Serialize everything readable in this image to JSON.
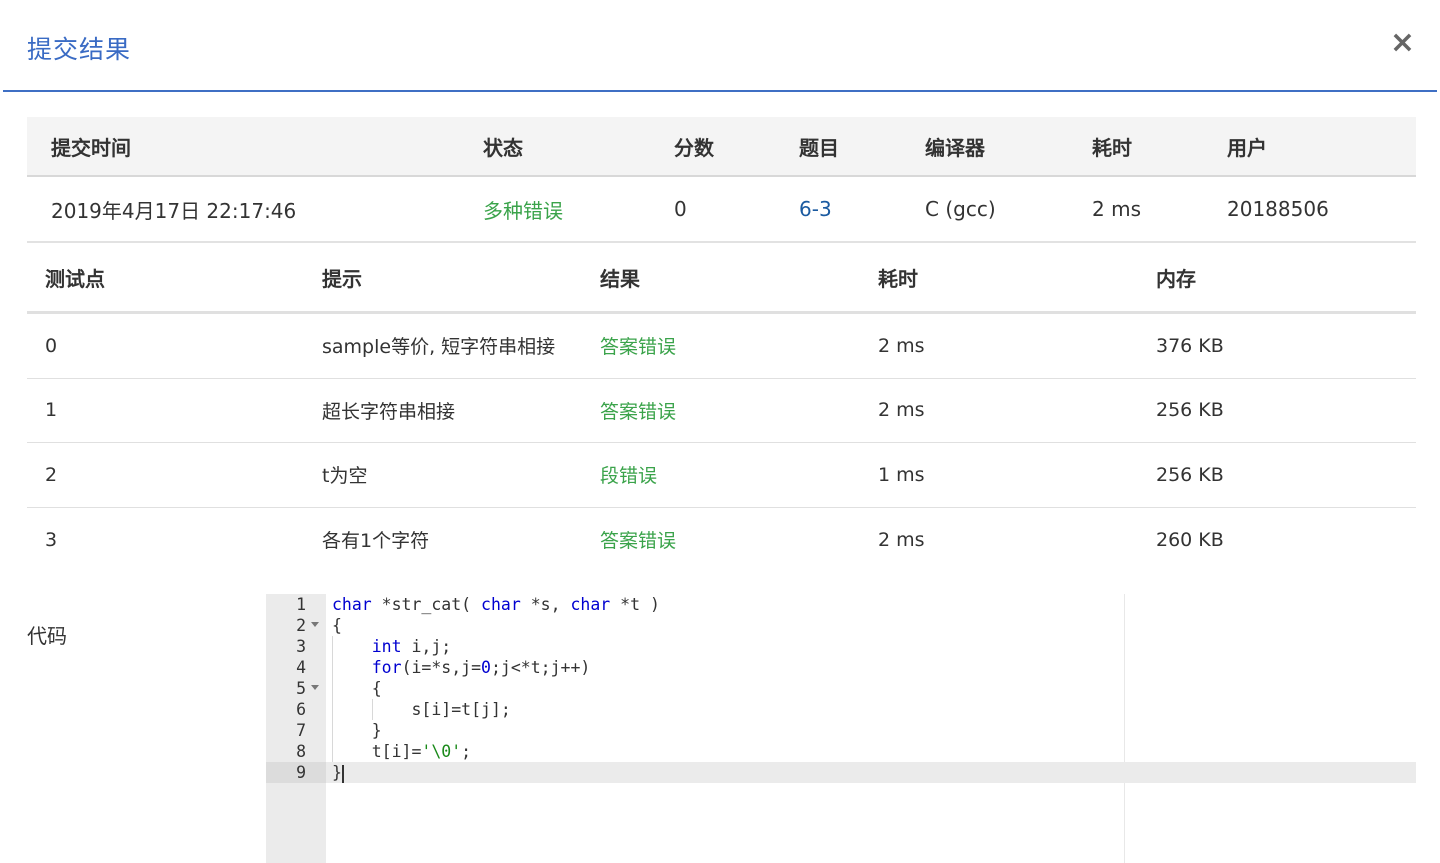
{
  "modal": {
    "title": "提交结果",
    "close_label": "×"
  },
  "summary": {
    "headers": [
      "提交时间",
      "状态",
      "分数",
      "题目",
      "编译器",
      "耗时",
      "用户"
    ],
    "row": {
      "time": "2019年4月17日 22:17:46",
      "status": "多种错误",
      "score": "0",
      "problem": "6-3",
      "compiler": "C (gcc)",
      "duration": "2 ms",
      "user": "20188506"
    }
  },
  "tests": {
    "headers": [
      "测试点",
      "提示",
      "结果",
      "耗时",
      "内存"
    ],
    "rows": [
      {
        "id": "0",
        "hint": "sample等价, 短字符串相接",
        "result": "答案错误",
        "time": "2 ms",
        "memory": "376 KB"
      },
      {
        "id": "1",
        "hint": "超长字符串相接",
        "result": "答案错误",
        "time": "2 ms",
        "memory": "256 KB"
      },
      {
        "id": "2",
        "hint": "t为空",
        "result": "段错误",
        "time": "1 ms",
        "memory": "256 KB"
      },
      {
        "id": "3",
        "hint": "各有1个字符",
        "result": "答案错误",
        "time": "2 ms",
        "memory": "260 KB"
      }
    ]
  },
  "code": {
    "label": "代码",
    "line_numbers": [
      "1",
      "2",
      "3",
      "4",
      "5",
      "6",
      "7",
      "8",
      "9"
    ],
    "lines": [
      "char *str_cat( char *s, char *t )",
      "{",
      "    int i,j;",
      "    for(i=*s,j=0;j<*t;j++)",
      "    {",
      "        s[i]=t[j];",
      "    }",
      "    t[i]='\\0';",
      "}"
    ],
    "active_line": 9,
    "fold_lines": [
      2,
      5
    ]
  },
  "colors": {
    "accent": "#3a6bc4",
    "success_text": "#3aa34a",
    "link": "#1a5aa0"
  }
}
